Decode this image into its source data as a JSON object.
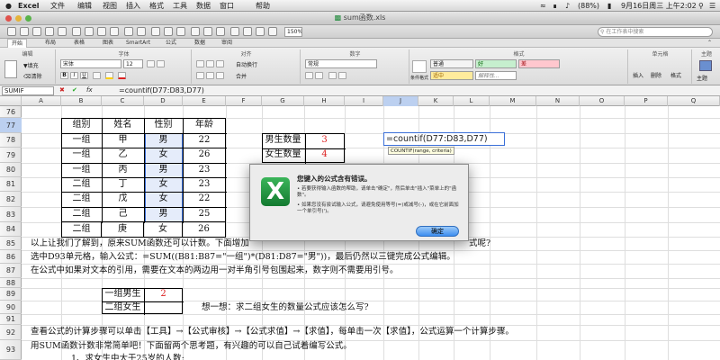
{
  "menubar": {
    "app": "Excel",
    "items": [
      "文件",
      "编辑",
      "视图",
      "插入",
      "格式",
      "工具",
      "数据",
      "窗口",
      "帮助"
    ],
    "battery": "(88%)",
    "datetime": "9月16日周三 上午2:02"
  },
  "titlebar": {
    "filename": "sum函数.xls"
  },
  "toolbar": {
    "zoom": "150%",
    "search_placeholder": "在工作表中搜索"
  },
  "ribbon": {
    "tabs": [
      "开始",
      "布局",
      "表格",
      "图表",
      "SmartArt",
      "公式",
      "数据",
      "审阅"
    ],
    "groups": {
      "edit": "编辑",
      "font": "字体",
      "align": "对齐",
      "number": "数字",
      "format": "格式",
      "cells": "单元格",
      "theme": "主题"
    },
    "fill_label": "填充",
    "clear_label": "清除",
    "font_name": "宋体",
    "font_size": "12",
    "wrap_label": "自动换行",
    "merge_label": "合并",
    "number_format": "常规",
    "styles": [
      "普通",
      "好",
      "差",
      "适中",
      "解释性..."
    ],
    "cond_format_label": "条件格式",
    "insert_label": "插入",
    "delete_label": "删除",
    "format_label": "格式",
    "theme_label": "主题"
  },
  "formula_bar": {
    "name_box": "SUMIF",
    "fx": "fx",
    "content": "=countif(D77:D83,D77)"
  },
  "columns": [
    "A",
    "B",
    "C",
    "D",
    "E",
    "F",
    "G",
    "H",
    "I",
    "J",
    "K",
    "L",
    "M",
    "N",
    "O",
    "P",
    "Q"
  ],
  "rows": [
    "76",
    "77",
    "78",
    "79",
    "80",
    "81",
    "82",
    "83",
    "84",
    "85",
    "86",
    "87",
    "88",
    "89",
    "90",
    "91",
    "92",
    "93"
  ],
  "table": {
    "headers": [
      "组别",
      "姓名",
      "性别",
      "年龄"
    ],
    "rows": [
      [
        "一组",
        "甲",
        "男",
        "22"
      ],
      [
        "一组",
        "乙",
        "女",
        "26"
      ],
      [
        "一组",
        "丙",
        "男",
        "23"
      ],
      [
        "二组",
        "丁",
        "女",
        "23"
      ],
      [
        "二组",
        "戊",
        "女",
        "22"
      ],
      [
        "二组",
        "己",
        "男",
        "25"
      ],
      [
        "二组",
        "庚",
        "女",
        "26"
      ]
    ]
  },
  "counts": {
    "male_label": "男生数量",
    "male_value": "3",
    "female_label": "女生数量",
    "female_value": "4"
  },
  "editing": {
    "formula": "=countif(D77:D83,D77)",
    "tooltip": "COUNTIF(range, criteria)"
  },
  "paragraphs": {
    "p85": "以上让我们了解到，原来SUM函数还可以计数。下面增加",
    "p85b": "式呢?",
    "p86": "选中D93单元格，输入公式：=SUM((B81:B87=\"一组\")*(D81:D87=\"男\"))，最后仍然以三键完成公式编辑。",
    "p87": "在公式中如果对文本的引用，需要在文本的两边用一对半角引号包围起来，数字则不需要用引号。",
    "p91": "查看公式的计算步骤可以单击【工具】→【公式审核】→【公式求值】→【求值】，每单击一次【求值】，公式运算一个计算步骤。",
    "p92": "用SUM函数计数非常简单吧！下面留两个思考题，有兴趣的可以自己试着编写公式。",
    "p93": "1、求女生中大于25岁的人数;"
  },
  "small_table": {
    "r1_label": "一组男生",
    "r1_value": "2",
    "r2_label": "二组女生",
    "r2_value": ""
  },
  "think": "想一想：求二组女生的数量公式应该怎么写?",
  "dialog": {
    "title": "您键入的公式含有错误。",
    "b1": "• 若要获得输入函数的帮助，请单击\"确定\"，然后单击\"插入\"菜单上的\"函数\"。",
    "b2": "• 如果您没有尝试输入公式，请避免使用等号(=)或减号(-)，或在它前面加一个单引号(')。",
    "ok": "确定"
  },
  "colors": {
    "excel_green": "#1f8a3a",
    "error_red": "#d22",
    "selection": "#b4c8f0"
  }
}
